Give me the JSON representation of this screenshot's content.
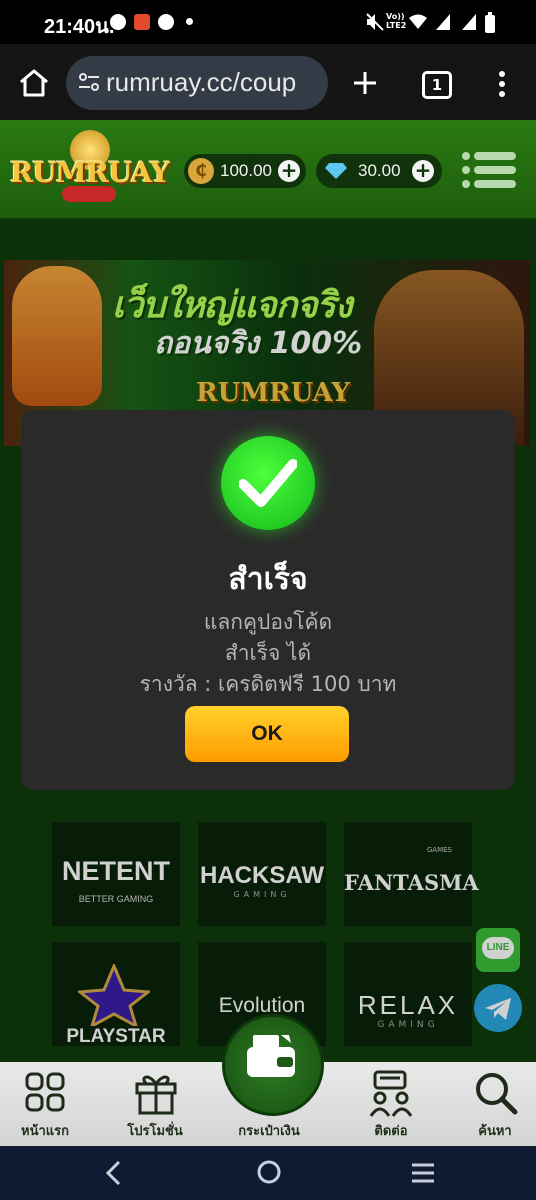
{
  "status_bar": {
    "time": "21:40น.",
    "indicators": [
      "chat-icon",
      "shop-icon",
      "line-icon",
      "dot",
      "mute-icon",
      "volte-icon",
      "wifi-icon",
      "signal-icon",
      "signal-icon",
      "battery-icon"
    ],
    "volte_label": "Vo)) LTE2"
  },
  "browser": {
    "url": "rumruay.cc/coup",
    "tab_count": "1"
  },
  "site_header": {
    "logo_text": "RUMRUAY",
    "coin_symbol": "₵",
    "credit_balance": "100.00",
    "diamond_balance": "30.00"
  },
  "banner": {
    "headline": "เว็บใหญ่แจกจริง",
    "subline": "ถอนจริง 100%",
    "brand": "RUMRUAY"
  },
  "providers": [
    {
      "name": "NETENT",
      "tagline": "BETTER GAMING"
    },
    {
      "name": "HACKSAW",
      "tagline": "GAMING"
    },
    {
      "name": "FANTASMA",
      "tagline": "GAMES"
    },
    {
      "name": "PLAYSTAR",
      "tagline": ""
    },
    {
      "name": "Evolution",
      "tagline": ""
    },
    {
      "name": "RELAX",
      "tagline": "GAMING"
    }
  ],
  "float_buttons": {
    "line_label": "LINE"
  },
  "modal": {
    "title": "สำเร็จ",
    "line1": "แลกคูปองโค้ด",
    "line2": "สำเร็จ ได้",
    "line3": "รางวัล : เครดิตฟรี 100 บาท",
    "ok_label": "OK"
  },
  "tabbar": {
    "home": "หน้าแรก",
    "promo": "โปรโมชั่น",
    "wallet": "กระเป๋าเงิน",
    "contact": "ติดต่อ",
    "search": "ค้นหา"
  },
  "colors": {
    "accent_green": "#1e5e0d",
    "modal_bg": "#2b2a2a",
    "ok_button": "#ffb300",
    "check_green": "#12b81a"
  }
}
